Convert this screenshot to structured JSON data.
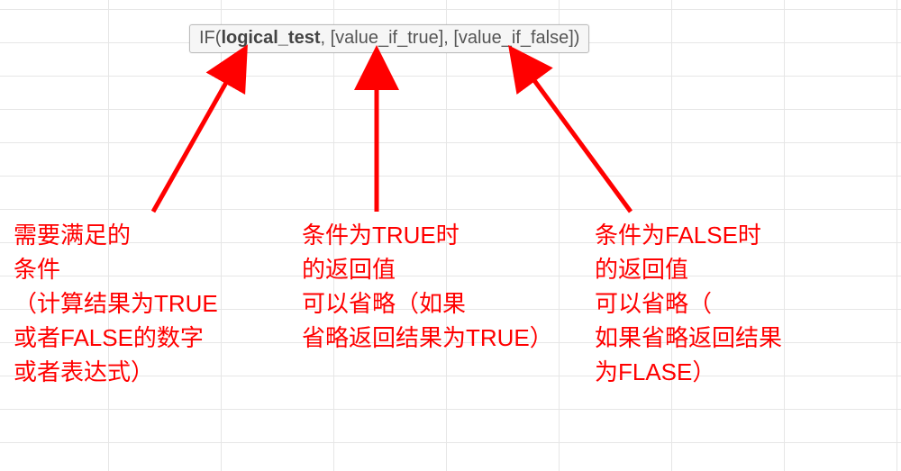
{
  "tooltip": {
    "prefix": "IF(",
    "arg1": "logical_test",
    "sep1": ", ",
    "arg2": "[value_if_true]",
    "sep2": ", ",
    "arg3": "[value_if_false]",
    "suffix": ")"
  },
  "arrows": {
    "arrow1": {
      "from_label": "logical_test",
      "to_label": "note1"
    },
    "arrow2": {
      "from_label": "value_if_true",
      "to_label": "note2"
    },
    "arrow3": {
      "from_label": "value_if_false",
      "to_label": "note3"
    }
  },
  "notes": {
    "note1": "需要满足的\n条件\n（计算结果为TRUE\n或者FALSE的数字\n或者表达式）",
    "note2": "条件为TRUE时\n的返回值\n可以省略（如果\n省略返回结果为TRUE）",
    "note3": "条件为FALSE时\n的返回值\n可以省略（\n如果省略返回结果\n为FLASE）"
  }
}
